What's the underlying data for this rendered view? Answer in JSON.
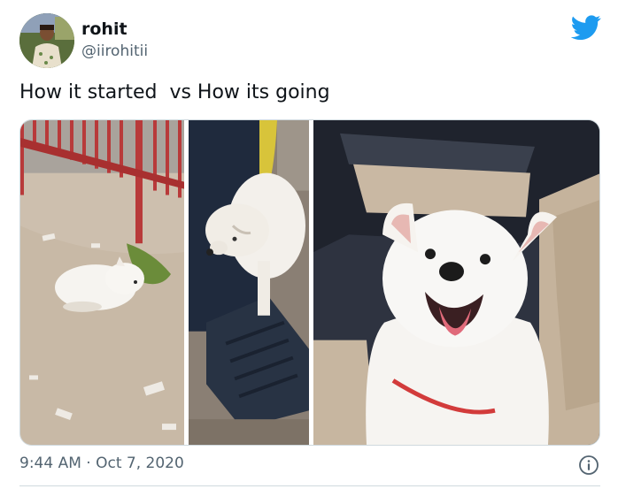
{
  "user": {
    "name": "rohit",
    "handle": "@iirohitii"
  },
  "tweet": {
    "text": "How it started  vs How its going",
    "time": "9:44 AM",
    "separator": "·",
    "date": "Oct 7, 2020"
  },
  "media": {
    "photos": [
      "photo-puppy-on-ground",
      "photo-puppy-on-scooter",
      "photo-dog-in-car"
    ]
  },
  "icons": {
    "logo": "twitter-bird-icon",
    "info": "info-icon"
  },
  "colors": {
    "twitter_blue": "#1d9bf0",
    "text_primary": "#0f1419",
    "text_secondary": "#536471",
    "border": "#cfd9de"
  }
}
